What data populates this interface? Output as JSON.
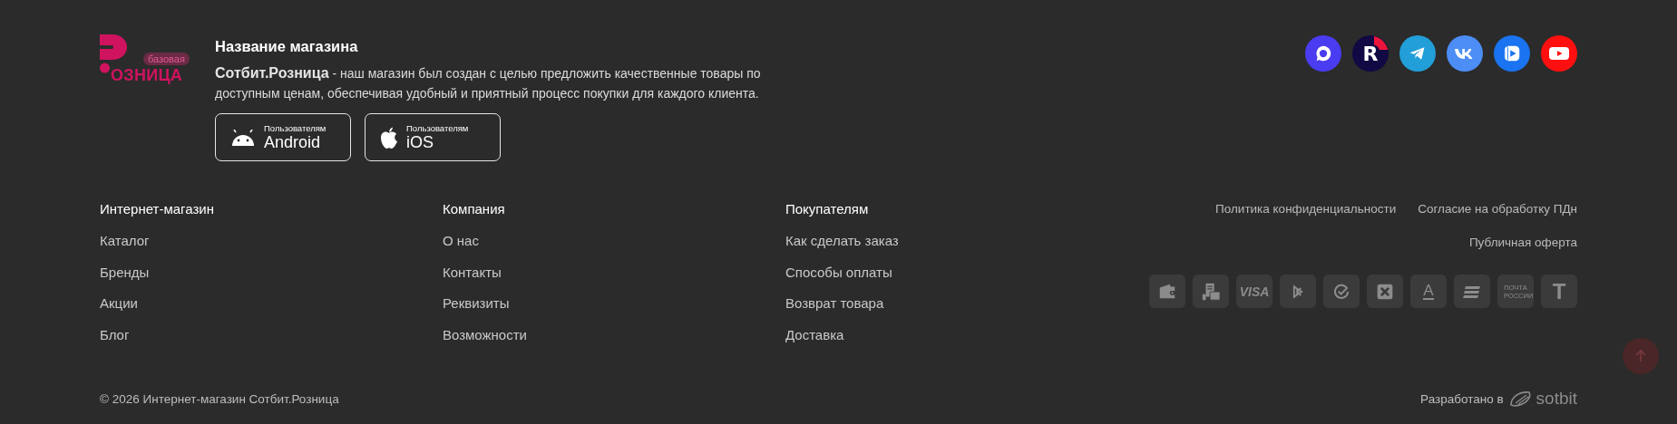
{
  "logo": {
    "badge": "базовая",
    "wordmark": "ОЗНИЦА"
  },
  "store": {
    "title": "Название магазина",
    "description": "**Сотбит.Розница** - наш магазин был создан с целью предложить качественные товары по доступным ценам, обеспечивая удобный и приятный процесс покупки для каждого клиента."
  },
  "app_buttons": [
    {
      "kind": "android",
      "caption": "Пользователям",
      "platform": "Android"
    },
    {
      "kind": "ios",
      "caption": "Пользователям",
      "platform": "iOS"
    }
  ],
  "socials": [
    {
      "kind": "max",
      "color": "#4a3cf0"
    },
    {
      "kind": "rutube",
      "color": "#100943",
      "label": "R"
    },
    {
      "kind": "telegram",
      "color": "#229ed9"
    },
    {
      "kind": "vk",
      "color": "#4c8df6"
    },
    {
      "kind": "vkvideo",
      "color": "#1a73f0"
    },
    {
      "kind": "youtube",
      "color": "#ff0f0f"
    }
  ],
  "columns": [
    {
      "title": "Интернет-магазин",
      "links": [
        "Каталог",
        "Бренды",
        "Акции",
        "Блог"
      ]
    },
    {
      "title": "Компания",
      "links": [
        "О нас",
        "Контакты",
        "Реквизиты",
        "Возможности"
      ]
    },
    {
      "title": "Покупателям",
      "links": [
        "Как сделать заказ",
        "Способы оплаты",
        "Возврат товара",
        "Доставка"
      ]
    }
  ],
  "legal_links": [
    [
      "Политика конфиденциальности",
      "Согласие на обработку ПДн"
    ],
    [
      "Публичная оферта"
    ]
  ],
  "payments": [
    {
      "kind": "wallet"
    },
    {
      "kind": "cards"
    },
    {
      "kind": "text",
      "label": "VISA"
    },
    {
      "kind": "sbp"
    },
    {
      "kind": "check"
    },
    {
      "kind": "cross"
    },
    {
      "kind": "underlined",
      "label": "A"
    },
    {
      "kind": "stripes"
    },
    {
      "kind": "small",
      "label": "ПОЧТА РОССИИ"
    },
    {
      "kind": "text",
      "label": "T"
    }
  ],
  "copyright": "© 2026 Интернет-магазин Сотбит.Розница",
  "developer": {
    "label": "Разработано в",
    "brand": "sotbit"
  }
}
